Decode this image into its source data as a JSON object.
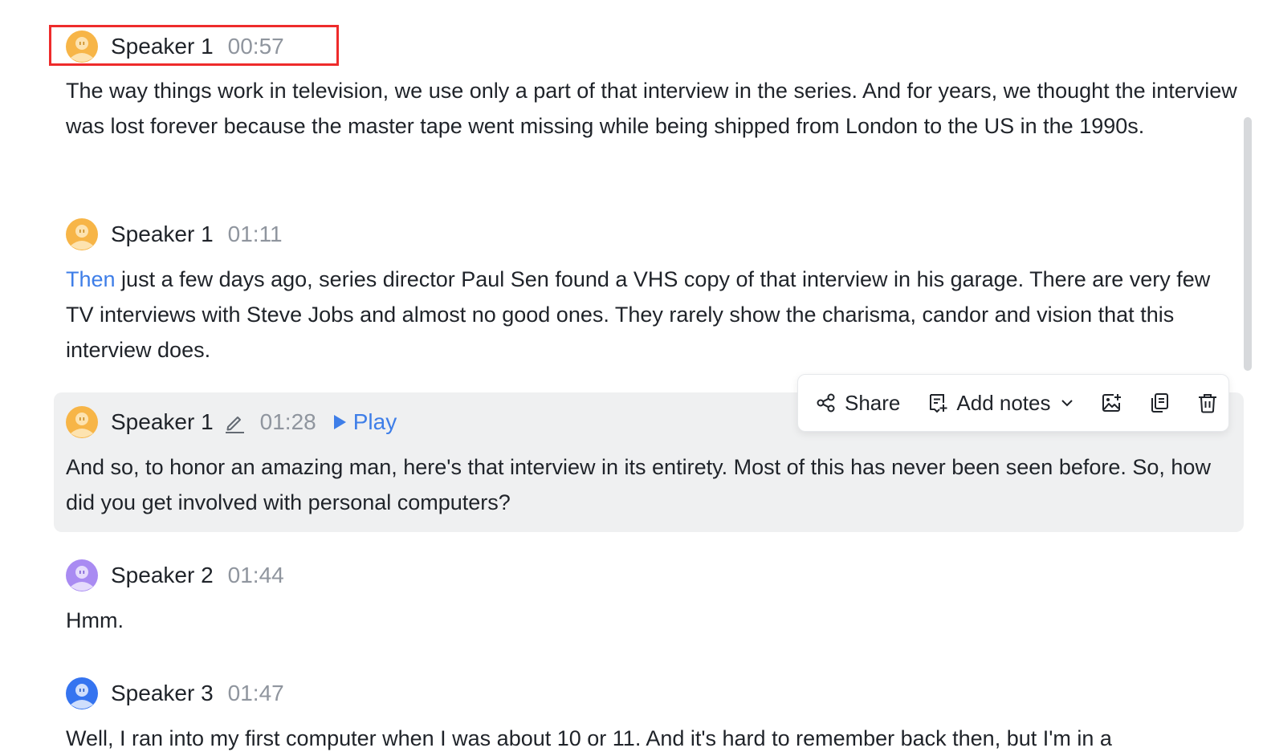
{
  "colors": {
    "accent": "#3e7ee8",
    "speaker_1_avatar": "#f7b547",
    "speaker_2_avatar": "#a98bf2",
    "speaker_3_avatar": "#3574f0",
    "highlight_box": "#ee2b2b",
    "active_block_bg": "#eff0f1"
  },
  "transcript": {
    "entries": [
      {
        "speaker": "Speaker 1",
        "time": "00:57",
        "text": "The way things work in television, we use only a part of that interview in the series. And for years, we thought the interview was lost forever because the master tape went missing while being shipped from London to the US in the 1990s."
      },
      {
        "speaker": "Speaker 1",
        "time": "01:11",
        "highlighted_word": "Then",
        "text_rest": " just a few days ago, series director Paul Sen found a VHS copy of that interview in his garage. There are very few TV interviews with Steve Jobs and almost no good ones. They rarely show the charisma, candor and vision that this interview does."
      },
      {
        "speaker": "Speaker 1",
        "time": "01:28",
        "play_label": "Play",
        "text": "And so, to honor an amazing man, here's that interview in its entirety. Most of this has never been seen before. So, how did you get involved with personal computers?"
      },
      {
        "speaker": "Speaker 2",
        "time": "01:44",
        "text": "Hmm."
      },
      {
        "speaker": "Speaker 3",
        "time": "01:47",
        "text": "Well, I ran into my first computer when I was about 10 or 11. And it's hard to remember back then, but I'm in a"
      }
    ]
  },
  "toolbar": {
    "share_label": "Share",
    "add_notes_label": "Add notes",
    "icons": [
      "share-icon",
      "add-notes-icon",
      "chevron-down-icon",
      "insert-image-icon",
      "copy-icon",
      "trash-icon"
    ]
  }
}
